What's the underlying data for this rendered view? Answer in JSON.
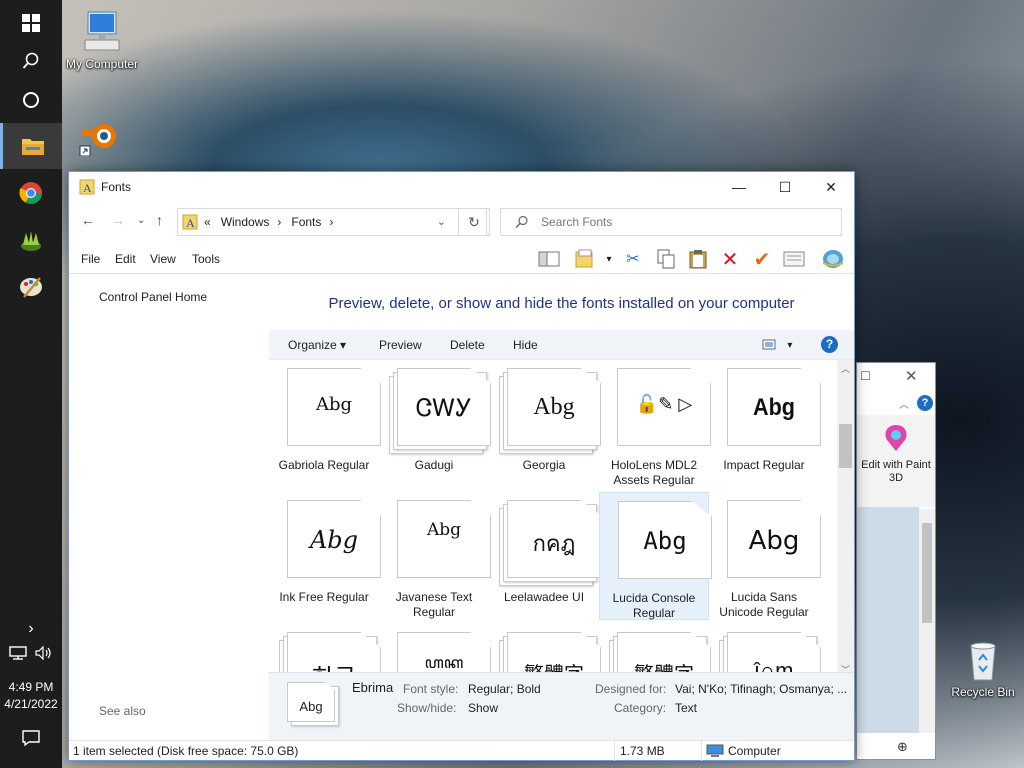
{
  "desktop": {
    "icons": [
      {
        "label": "My Computer"
      },
      {
        "label": "Recycle Bin"
      }
    ]
  },
  "taskbar": {
    "time": "4:49 PM",
    "date": "4/21/2022"
  },
  "window": {
    "title": "Fonts",
    "controls": {
      "minimize": "—",
      "maximize": "☐",
      "close": "✕"
    },
    "breadcrumb": [
      "«",
      "Windows",
      "›",
      "Fonts",
      "›"
    ],
    "search_placeholder": "Search Fonts",
    "menu": [
      "File",
      "Edit",
      "View",
      "Tools"
    ],
    "left_pane": {
      "home_link": "Control Panel Home",
      "see_also": "See also"
    },
    "heading": "Preview, delete, or show and hide the fonts installed on your computer",
    "commands": {
      "organize": "Organize ▾",
      "preview": "Preview",
      "delete": "Delete",
      "hide": "Hide"
    },
    "fonts": [
      {
        "name": "Gabriola Regular",
        "sample": "Abg",
        "stack": false
      },
      {
        "name": "Gadugi",
        "sample": "ᏣᎳᎩ",
        "stack": true
      },
      {
        "name": "Georgia",
        "sample": "Abg",
        "stack": true
      },
      {
        "name": "HoloLens MDL2 Assets Regular",
        "sample": "🔓✎ ▷",
        "stack": false
      },
      {
        "name": "Impact Regular",
        "sample": "Abg",
        "stack": false
      },
      {
        "name": "Ink Free Regular",
        "sample": "Abg",
        "stack": false
      },
      {
        "name": "Javanese Text Regular",
        "sample": "Abg",
        "stack": false
      },
      {
        "name": "Leelawadee UI",
        "sample": "กคฎ",
        "stack": true
      },
      {
        "name": "Lucida Console Regular",
        "sample": "Abg",
        "stack": false,
        "selected": true
      },
      {
        "name": "Lucida Sans Unicode Regular",
        "sample": "Abg",
        "stack": false
      },
      {
        "name": "",
        "sample": "한글",
        "stack": true
      },
      {
        "name": "",
        "sample": "ꦲꦏ",
        "stack": false
      },
      {
        "name": "",
        "sample": "繁體字",
        "stack": true
      },
      {
        "name": "",
        "sample": "繁體字",
        "stack": true
      },
      {
        "name": "",
        "sample": "ĵ∩m",
        "stack": true
      }
    ],
    "details": {
      "font_name": "Ebrima",
      "preview": "Abg",
      "font_style_label": "Font style:",
      "font_style": "Regular; Bold",
      "show_hide_label": "Show/hide:",
      "show_hide": "Show",
      "designed_for_label": "Designed for:",
      "designed_for": "Vai; N'Ko; Tifinagh; Osmanya; ...",
      "category_label": "Category:",
      "category": "Text"
    },
    "status": {
      "selection": "1 item selected (Disk free space: 75.0 GB)",
      "size": "1.73 MB",
      "location": "Computer"
    }
  },
  "background_window": {
    "action_label": "Edit with Paint 3D"
  }
}
